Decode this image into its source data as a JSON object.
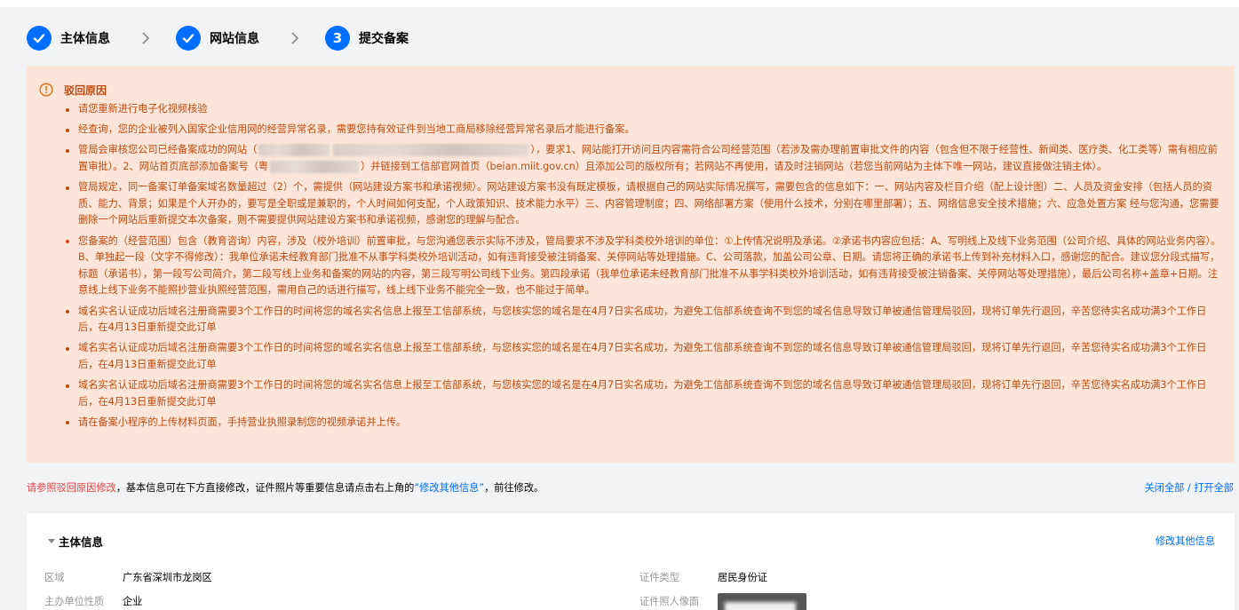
{
  "steps": [
    {
      "label": "主体信息",
      "state": "done"
    },
    {
      "label": "网站信息",
      "state": "done"
    },
    {
      "label": "提交备案",
      "state": "current",
      "number": "3"
    }
  ],
  "reject": {
    "title": "驳回原因",
    "items": [
      "请您重新进行电子化视频核验",
      "经查询，您的企业被列入国家企业信用网的经营异常名录，需要您持有效证件到当地工商局移除经营异常名录后才能进行备案。",
      "管局会审核您公司已经备案成功的网站（",
      "），要求1、网站能打开访问且内容需符合公司经营范围（若涉及需办理前置审批文件的内容（包含但不限于经营性、新闻类、医疗类、化工类等）需有相应前置审批）。2、网站首页底部添加备案号（粤",
      "）并链接到工信部官网首页（beian.miit.gov.cn）且添加公司的版权所有；若网站不再使用，请及时注销网站（若您当前网站为主体下唯一网站，建议直接做注销主体）。",
      "管局规定，同一备案订单备案域名数量超过（2）个，需提供（网站建设方案书和承诺视频）。网站建设方案书没有既定模板，请根据自己的网站实际情况撰写，需要包含的信息如下：一、网站内容及栏目介绍（配上设计图）二、人员及资金安排（包括人员的资质、能力、背景；如果是个人开办的，要写是全职或是兼职的，个人时间如何支配，个人政策知识、技术能力水平）三、内容管理制度；四、网络部署方案（使用什么技术，分别在哪里部署）；五、网络信息安全技术措施；六、应急处置方案 经与您沟通，您需要删除一个网站后重新提交本次备案，则不需要提供网站建设方案书和承诺视频，感谢您的理解与配合。",
      "您备案的（经营范围）包含（教育咨询）内容，涉及（校外培训）前置审批，与您沟通您表示实际不涉及，管局要求不涉及学科类校外培训的单位：①上传情况说明及承诺。②承诺书内容应包括：A、写明线上及线下业务范围（公司介绍、具体的网站业务内容）。B、单独起一段（文字不得修改）：我单位承诺未经教育部门批准不从事学科类校外培训活动，如有违背接受被注销备案、关停网站等处理措施。C、公司落款，加盖公司公章、日期。请您将正确的承诺书上传到补充材料入口，感谢您的配合。建议您分段式描写，标题（承诺书），第一段写公司简介，第二段写线上业务和备案的网站的内容，第三段写明公司线下业务。第四段承诺（我单位承诺未经教育部门批准不从事学科类校外培训活动，如有违背接受被注销备案、关停网站等处理措施），最后公司名称+盖章+日期。注意线上线下业务不能照抄营业执照经营范围，需用自己的话进行描写，线上线下业务不能完全一致，也不能过于简单。",
      "域名实名认证成功后域名注册商需要3个工作日的时间将您的域名实名信息上报至工信部系统，与您核实您的域名是在4月7日实名成功，为避免工信部系统查询不到您的域名信息导致订单被通信管理局驳回，现将订单先行退回，辛苦您待实名成功满3个工作日后，在4月13日重新提交此订单",
      "请在备案小程序的上传材料页面，手持营业执照录制您的视频承诺并上传。"
    ]
  },
  "notice": {
    "red": "请参照驳回原因修改",
    "text1": "，基本信息可在下方直接修改，证件照片等重要信息请点击右上角的",
    "link": "“修改其他信息”",
    "text2": "，前往修改。"
  },
  "toggle_all": "关闭全部 / 打开全部",
  "card": {
    "title": "主体信息",
    "edit": "修改其他信息",
    "fields": {
      "region_k": "区域",
      "region_v": "广东省深圳市龙岗区",
      "nature_k": "主办单位性质",
      "nature_v": "企业",
      "idtype_k": "证件类型",
      "idtype_v": "居民身份证",
      "photo_k": "证件照人像面"
    }
  },
  "colors": {
    "accent": "#006eff",
    "warn_bg": "#fde6d9",
    "warn_text": "#bf4a0f",
    "red": "#e54545"
  }
}
